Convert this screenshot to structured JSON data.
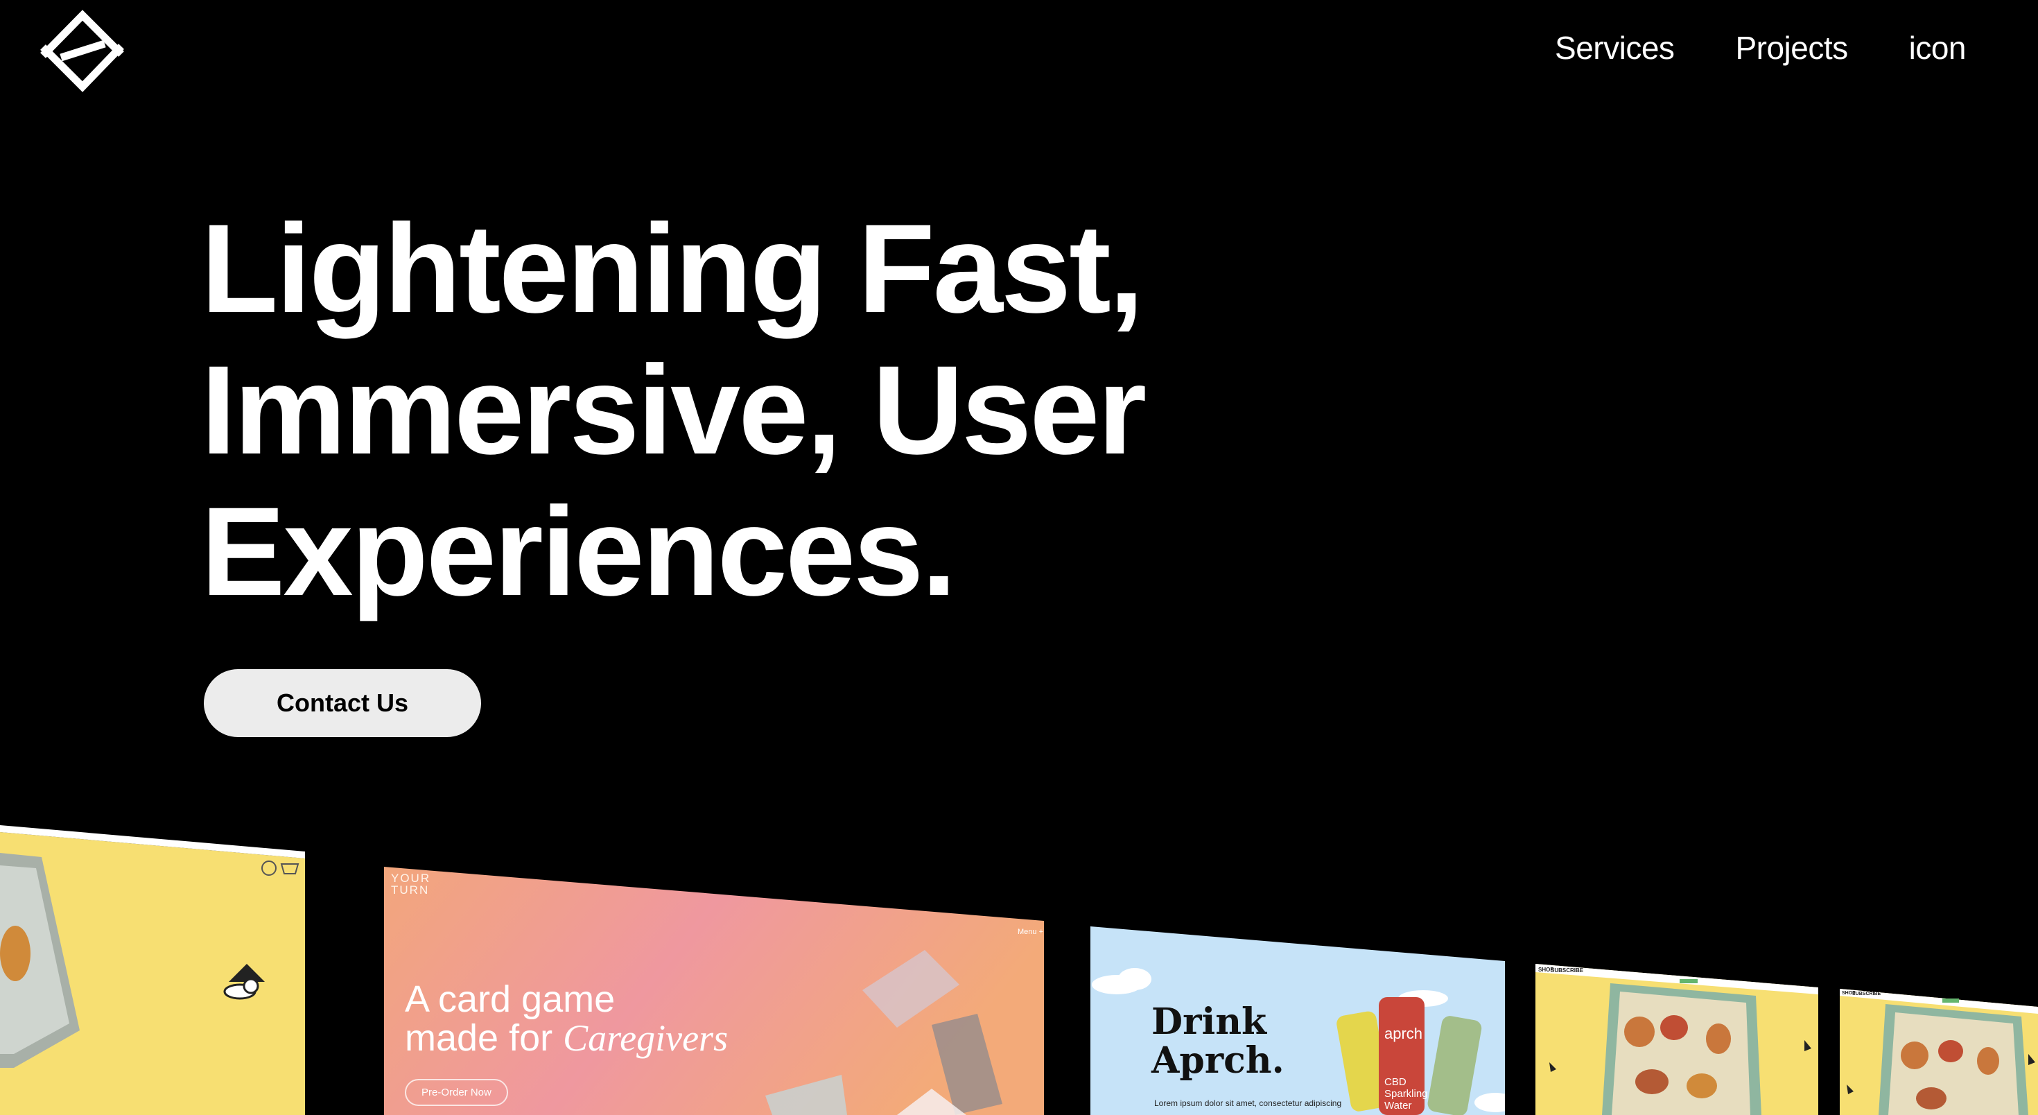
{
  "logo": {
    "icon": "z-diamond-logo-icon"
  },
  "nav": {
    "items": [
      "Services",
      "Projects",
      "icon"
    ]
  },
  "hero": {
    "lines": [
      "Lightening Fast,",
      "Immersive, User",
      "Experiences."
    ],
    "cta": "Contact Us"
  },
  "projects": {
    "card2": {
      "brand": "YOUR\nTURN",
      "menu": "Menu +",
      "headline_1": "A card game",
      "headline_2": "made for",
      "headline_italic": "Caregivers",
      "button": "Pre-Order Now"
    },
    "card3": {
      "headline_1": "Drink",
      "headline_2": "Aprch.",
      "can_label": "aprch",
      "can_desc": "CBD\nSparkling\nWater",
      "body": "Lorem ipsum dolor sit amet, consectetur adipiscing"
    },
    "card4": {
      "nav_1": "SHOP",
      "nav_2": "SUBSCRIBE"
    },
    "card5": {
      "nav_1": "SHOP",
      "nav_2": "SUBSCRIBE"
    }
  },
  "colors": {
    "background": "#000000",
    "foreground": "#ffffff",
    "cta_background": "#ececec",
    "card_yellow": "#f7df72",
    "card_sky": "#c6e3f8",
    "card_peach": "#f3a97f",
    "card_pink": "#ef9aa0"
  }
}
